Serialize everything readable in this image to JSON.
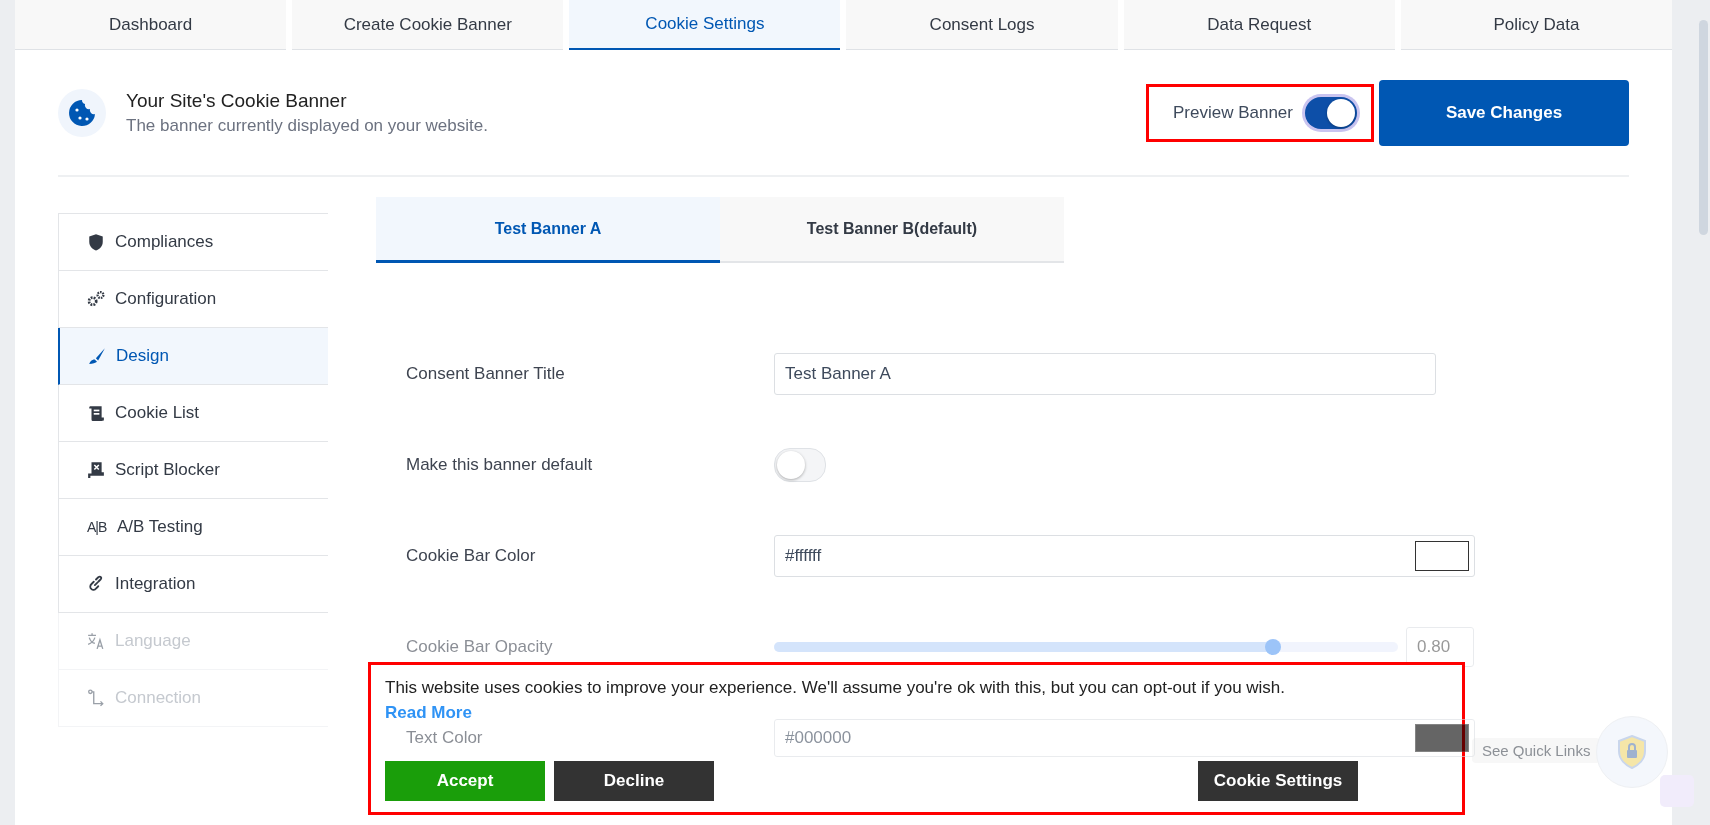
{
  "tabs": [
    {
      "label": "Dashboard",
      "selected": false
    },
    {
      "label": "Create Cookie Banner",
      "selected": false
    },
    {
      "label": "Cookie Settings",
      "selected": true
    },
    {
      "label": "Consent Logs",
      "selected": false
    },
    {
      "label": "Data Request",
      "selected": false
    },
    {
      "label": "Policy Data",
      "selected": false
    }
  ],
  "header": {
    "title": "Your Site's Cookie Banner",
    "subtitle": "The banner currently displayed on your website.",
    "preview": {
      "label": "Preview Banner",
      "on": true,
      "highlighted": true
    },
    "save_button": "Save Changes"
  },
  "sidebar": {
    "items": [
      {
        "label": "Compliances",
        "selected": false,
        "dimmed": false
      },
      {
        "label": "Configuration",
        "selected": false,
        "dimmed": false
      },
      {
        "label": "Design",
        "selected": true,
        "dimmed": false
      },
      {
        "label": "Cookie List",
        "selected": false,
        "dimmed": false
      },
      {
        "label": "Script Blocker",
        "selected": false,
        "dimmed": false
      },
      {
        "label": "A/B Testing",
        "glyph": "A|B",
        "selected": false,
        "dimmed": false
      },
      {
        "label": "Integration",
        "selected": false,
        "dimmed": false
      },
      {
        "label": "Language",
        "selected": false,
        "dimmed": true
      },
      {
        "label": "Connection",
        "selected": false,
        "dimmed": true
      }
    ]
  },
  "banner_tabs": [
    {
      "label": "Test Banner A",
      "selected": true
    },
    {
      "label": "Test Banner B(default)",
      "selected": false
    }
  ],
  "form": [
    {
      "kind": "text",
      "label": "Consent Banner Title",
      "value": "Test Banner A",
      "dimmed": false
    },
    {
      "kind": "toggle",
      "label": "Make this banner default",
      "on": false,
      "dimmed": false
    },
    {
      "kind": "color",
      "label": "Cookie Bar Color",
      "value": "#ffffff",
      "dimmed": false
    },
    {
      "kind": "slider",
      "label": "Cookie Bar Opacity",
      "level": 0.8,
      "reading": "0.80",
      "dimmed": true
    },
    {
      "kind": "color",
      "label": "Text Color",
      "value": "#000000",
      "dimmed": true
    }
  ],
  "cookie_banner": {
    "highlighted": true,
    "message": "This website uses cookies to improve your experience. We'll assume you're ok with this, but you can opt-out if you wish.",
    "link": "Read More",
    "buttons": [
      {
        "label": "Accept",
        "kind": "accept"
      },
      {
        "label": "Decline",
        "kind": "decline"
      },
      {
        "label": "Cookie Settings",
        "kind": "settings"
      }
    ]
  },
  "quick_links": {
    "label": "See Quick Links"
  }
}
